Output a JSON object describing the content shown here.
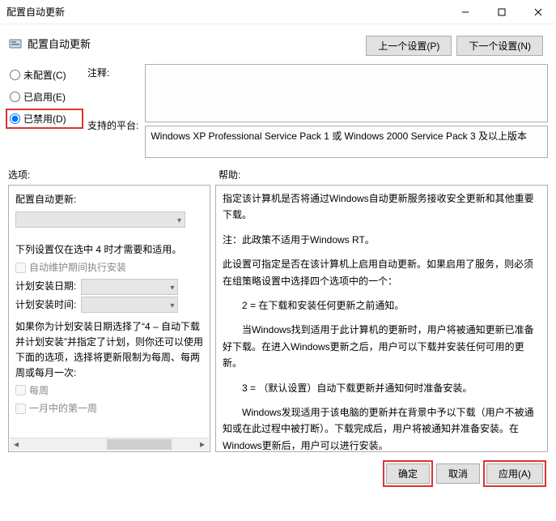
{
  "window": {
    "title": "配置自动更新"
  },
  "header": {
    "page_title": "配置自动更新",
    "prev_btn": "上一个设置(P)",
    "next_btn": "下一个设置(N)"
  },
  "radios": {
    "not_configured": "未配置(C)",
    "enabled": "已启用(E)",
    "disabled": "已禁用(D)"
  },
  "labels": {
    "comment": "注释:",
    "supported": "支持的平台:",
    "options": "选项:",
    "help": "帮助:"
  },
  "comment_text": "",
  "supported_text": "Windows XP Professional Service Pack 1 或 Windows 2000 Service Pack 3 及以上版本",
  "options_pane": {
    "heading": "配置自动更新:",
    "note": "下列设置仅在选中 4 时才需要和适用。",
    "chk_maintenance": "自动维护期间执行安装",
    "sched_day_label": "计划安装日期:",
    "sched_time_label": "计划安装时间:",
    "para1": "如果你为计划安装日期选择了“4 – 自动下载并计划安装”并指定了计划，则你还可以使用下面的选项，选择将更新限制为每周、每两周或每月一次:",
    "chk_weekly": "每周",
    "chk_month_first": "一月中的第一周"
  },
  "help_pane": {
    "p1": "指定该计算机是否将通过Windows自动更新服务接收安全更新和其他重要下载。",
    "p2": "注：此政策不适用于Windows RT。",
    "p3": "此设置可指定是否在该计算机上启用自动更新。如果启用了服务，则必须在组策略设置中选择四个选项中的一个：",
    "p4": "　　2 = 在下载和安装任何更新之前通知。",
    "p5": "　　当Windows找到适用于此计算机的更新时，用户将被通知更新已准备好下载。在进入Windows更新之后，用户可以下载并安装任何可用的更新。",
    "p6": "　　3 = （默认设置）自动下载更新并通知何时准备安装。",
    "p7": "　　Windows发现适用于该电脑的更新并在背景中予以下载（用户不被通知或在此过程中被打断）。下载完成后，用户将被通知并准备安装。在Windows更新后，用户可以进行安装。"
  },
  "footer": {
    "ok": "确定",
    "cancel": "取消",
    "apply": "应用(A)"
  }
}
